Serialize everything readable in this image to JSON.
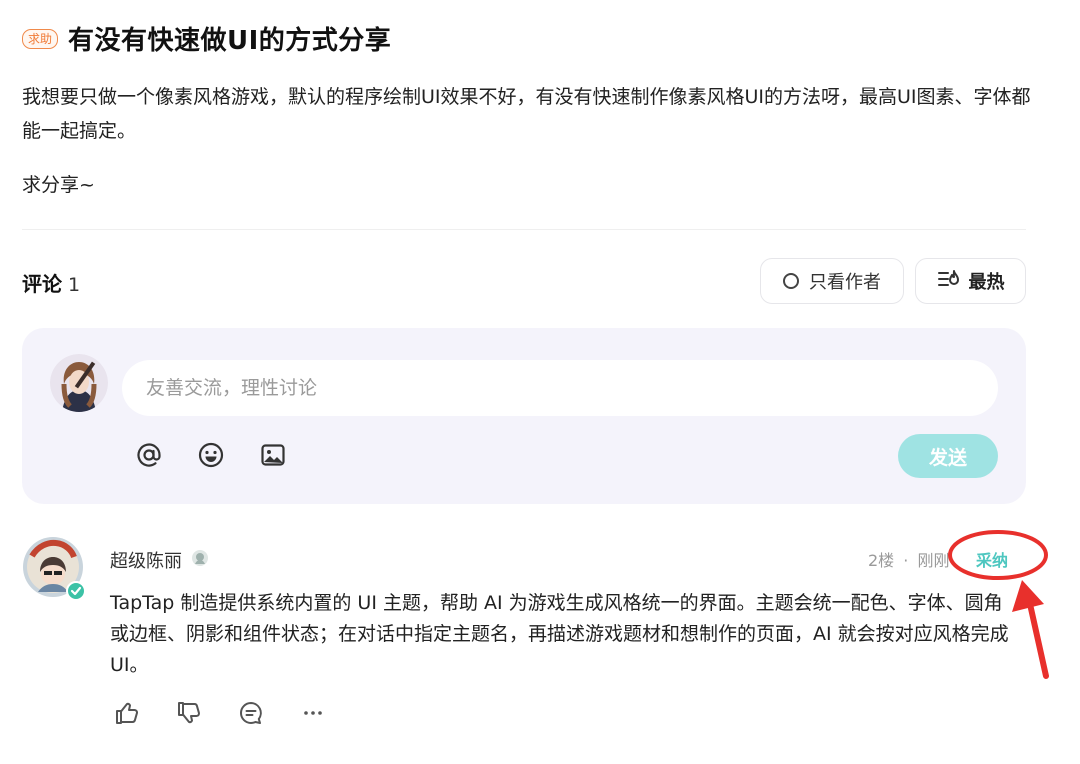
{
  "post": {
    "tag": "求助",
    "title": "有没有快速做UI的方式分享",
    "paragraphs": [
      "我想要只做一个像素风格游戏，默认的程序绘制UI效果不好，有没有快速制作像素风格UI的方法呀，最高UI图素、字体都能一起搞定。",
      "求分享~"
    ]
  },
  "comments_header": {
    "label": "评论",
    "count": "1",
    "author_only_label": "只看作者",
    "sort_label": "最热"
  },
  "composer": {
    "placeholder": "友善交流，理性讨论",
    "send_label": "发送",
    "tools": [
      "at-icon",
      "emoji-icon",
      "image-icon"
    ]
  },
  "reply": {
    "username": "超级陈丽",
    "floor": "2楼",
    "separator": "·",
    "time": "刚刚",
    "adopt_label": "采纳",
    "text": "TapTap 制造提供系统内置的 UI 主题，帮助 AI 为游戏生成风格统一的界面。主题会统一配色、字体、圆角或边框、阴影和组件状态；在对话中指定主题名，再描述游戏题材和想制作的页面，AI 就会按对应风格完成 UI。",
    "actions": [
      "like-icon",
      "dislike-icon",
      "reply-icon",
      "more-icon"
    ]
  },
  "colors": {
    "accent": "#4ec7c0",
    "send_button": "#9fe3e3",
    "tag_orange": "#f07a35",
    "annotation_red": "#e8302c",
    "composer_bg": "#f4f3fb"
  }
}
